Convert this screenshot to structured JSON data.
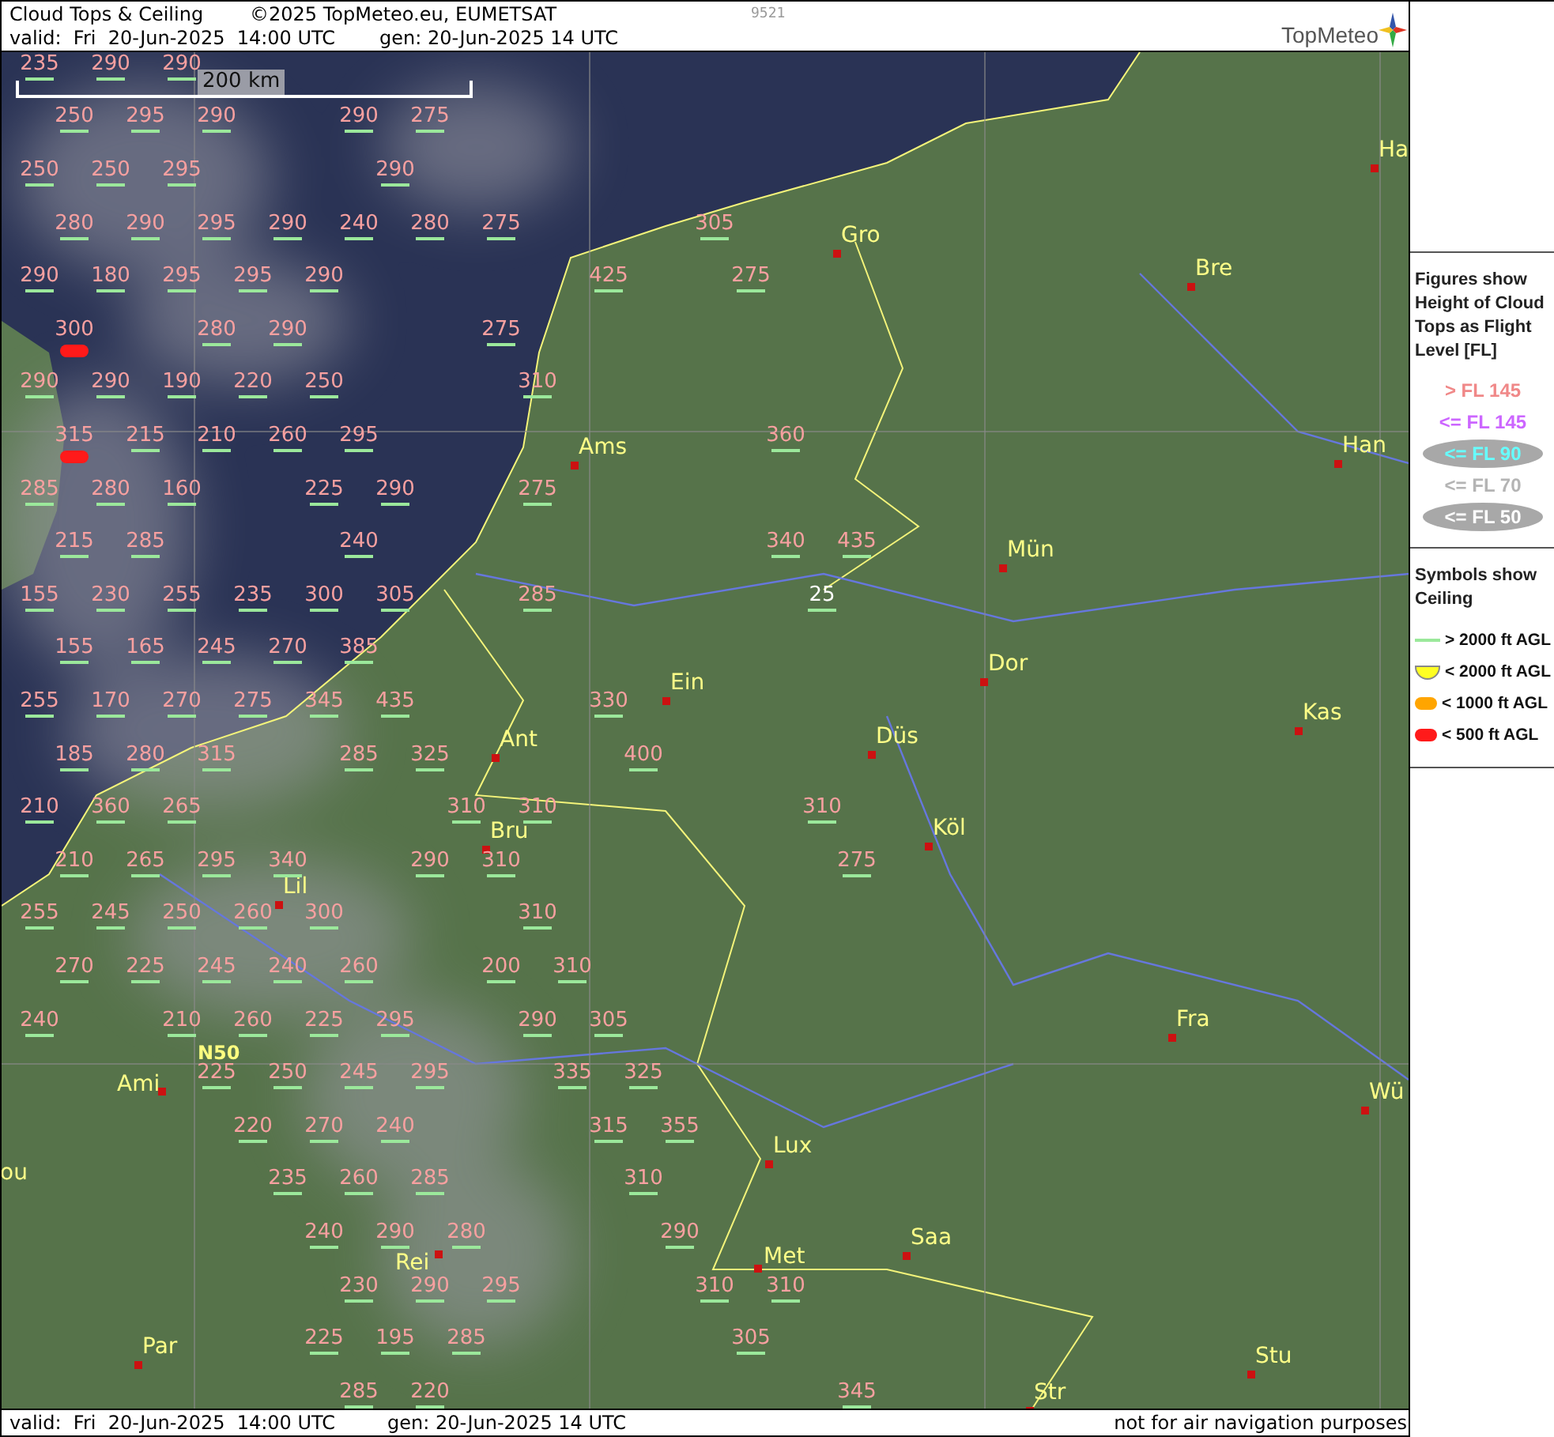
{
  "header": {
    "title": "Cloud Tops & Ceiling",
    "copyright": "©2025 TopMeteo.eu, EUMETSAT",
    "code": "9521",
    "valid": "valid:  Fri  20-Jun-2025  14:00 UTC",
    "generated": "gen: 20-Jun-2025 14 UTC",
    "logo": "TopMeteo"
  },
  "map": {
    "scale": "200 km",
    "grid_label": "N50",
    "rows": [
      [
        {
          "fl": "235",
          "color": "#f7a0a0",
          "kind": "line"
        },
        {
          "fl": "290",
          "color": "#f7a0a0",
          "kind": "line"
        },
        {
          "fl": "290",
          "color": "#f7a0a0",
          "kind": "line"
        }
      ],
      [
        {
          "fl": "250",
          "color": "#f7a0a0",
          "kind": "line"
        },
        {
          "fl": "295",
          "color": "#f7a0a0",
          "kind": "line"
        },
        {
          "fl": "290",
          "color": "#f7a0a0",
          "kind": "line"
        },
        null,
        {
          "fl": "290",
          "color": "#f7a0a0",
          "kind": "line"
        },
        {
          "fl": "275",
          "color": "#f7a0a0",
          "kind": "line"
        }
      ],
      [
        {
          "fl": "250",
          "color": "#f7a0a0",
          "kind": "line"
        },
        {
          "fl": "250",
          "color": "#f7a0a0",
          "kind": "line"
        },
        {
          "fl": "295",
          "color": "#f7a0a0",
          "kind": "line"
        },
        null,
        null,
        {
          "fl": "290",
          "color": "#f7a0a0",
          "kind": "line"
        }
      ],
      [
        {
          "fl": "280",
          "color": "#f7a0a0",
          "kind": "line"
        },
        {
          "fl": "290",
          "color": "#f7a0a0",
          "kind": "line"
        },
        {
          "fl": "295",
          "color": "#f7a0a0",
          "kind": "line"
        },
        {
          "fl": "290",
          "color": "#f7a0a0",
          "kind": "line"
        },
        {
          "fl": "240",
          "color": "#f7a0a0",
          "kind": "line"
        },
        {
          "fl": "280",
          "color": "#f7a0a0",
          "kind": "line"
        },
        {
          "fl": "275",
          "color": "#f7a0a0",
          "kind": "line"
        },
        null,
        null,
        {
          "fl": "305",
          "color": "#f7a0a0",
          "kind": "line"
        }
      ],
      [
        {
          "fl": "290",
          "color": "#f7a0a0",
          "kind": "line"
        },
        {
          "fl": "180",
          "color": "#f7a0a0",
          "kind": "line"
        },
        {
          "fl": "295",
          "color": "#f7a0a0",
          "kind": "line"
        },
        {
          "fl": "295",
          "color": "#f7a0a0",
          "kind": "line"
        },
        {
          "fl": "290",
          "color": "#f7a0a0",
          "kind": "line"
        },
        null,
        null,
        null,
        {
          "fl": "425",
          "color": "#f7a0a0",
          "kind": "line"
        },
        null,
        {
          "fl": "275",
          "color": "#f7a0a0",
          "kind": "line"
        }
      ],
      [
        {
          "fl": "300",
          "color": "#f7a0a0",
          "kind": "red"
        },
        null,
        {
          "fl": "280",
          "color": "#f7a0a0",
          "kind": "line"
        },
        {
          "fl": "290",
          "color": "#f7a0a0",
          "kind": "line"
        },
        null,
        null,
        {
          "fl": "275",
          "color": "#f7a0a0",
          "kind": "line"
        }
      ],
      [
        {
          "fl": "290",
          "color": "#f7a0a0",
          "kind": "line"
        },
        {
          "fl": "290",
          "color": "#f7a0a0",
          "kind": "line"
        },
        {
          "fl": "190",
          "color": "#f7a0a0",
          "kind": "line"
        },
        {
          "fl": "220",
          "color": "#f7a0a0",
          "kind": "line"
        },
        {
          "fl": "250",
          "color": "#f7a0a0",
          "kind": "line"
        },
        null,
        null,
        {
          "fl": "310",
          "color": "#f7a0a0",
          "kind": "line"
        }
      ],
      [
        {
          "fl": "315",
          "color": "#f7a0a0",
          "kind": "red"
        },
        {
          "fl": "215",
          "color": "#f7a0a0",
          "kind": "line"
        },
        {
          "fl": "210",
          "color": "#f7a0a0",
          "kind": "line"
        },
        {
          "fl": "260",
          "color": "#f7a0a0",
          "kind": "line"
        },
        {
          "fl": "295",
          "color": "#f7a0a0",
          "kind": "line"
        },
        null,
        null,
        null,
        null,
        null,
        {
          "fl": "360",
          "color": "#f7a0a0",
          "kind": "line"
        }
      ],
      [
        {
          "fl": "285",
          "color": "#f7a0a0",
          "kind": "line"
        },
        {
          "fl": "280",
          "color": "#f7a0a0",
          "kind": "line"
        },
        {
          "fl": "160",
          "color": "#f7a0a0",
          "kind": "line"
        },
        null,
        {
          "fl": "225",
          "color": "#f7a0a0",
          "kind": "line"
        },
        {
          "fl": "290",
          "color": "#f7a0a0",
          "kind": "line"
        },
        null,
        {
          "fl": "275",
          "color": "#f7a0a0",
          "kind": "line"
        }
      ],
      [
        {
          "fl": "215",
          "color": "#f7a0a0",
          "kind": "line"
        },
        {
          "fl": "285",
          "color": "#f7a0a0",
          "kind": "line"
        },
        null,
        null,
        {
          "fl": "240",
          "color": "#f7a0a0",
          "kind": "line"
        },
        null,
        null,
        null,
        null,
        null,
        {
          "fl": "340",
          "color": "#f7a0a0",
          "kind": "line"
        },
        {
          "fl": "435",
          "color": "#f7a0a0",
          "kind": "line"
        }
      ],
      [
        {
          "fl": "155",
          "color": "#f7a0a0",
          "kind": "line"
        },
        {
          "fl": "230",
          "color": "#f7a0a0",
          "kind": "line"
        },
        {
          "fl": "255",
          "color": "#f7a0a0",
          "kind": "line"
        },
        {
          "fl": "235",
          "color": "#f7a0a0",
          "kind": "line"
        },
        {
          "fl": "300",
          "color": "#f7a0a0",
          "kind": "line"
        },
        {
          "fl": "305",
          "color": "#f7a0a0",
          "kind": "line"
        },
        null,
        {
          "fl": "285",
          "color": "#f7a0a0",
          "kind": "line"
        },
        null,
        null,
        null,
        {
          "fl": "25",
          "color": "#ffffff",
          "kind": "line"
        }
      ],
      [
        {
          "fl": "155",
          "color": "#f7a0a0",
          "kind": "line"
        },
        {
          "fl": "165",
          "color": "#f7a0a0",
          "kind": "line"
        },
        {
          "fl": "245",
          "color": "#f7a0a0",
          "kind": "line"
        },
        {
          "fl": "270",
          "color": "#f7a0a0",
          "kind": "line"
        },
        {
          "fl": "385",
          "color": "#f7a0a0",
          "kind": "line"
        }
      ],
      [
        {
          "fl": "255",
          "color": "#f7a0a0",
          "kind": "line"
        },
        {
          "fl": "170",
          "color": "#f7a0a0",
          "kind": "line"
        },
        {
          "fl": "270",
          "color": "#f7a0a0",
          "kind": "line"
        },
        {
          "fl": "275",
          "color": "#f7a0a0",
          "kind": "line"
        },
        {
          "fl": "345",
          "color": "#f7a0a0",
          "kind": "line"
        },
        {
          "fl": "435",
          "color": "#f7a0a0",
          "kind": "line"
        },
        null,
        null,
        {
          "fl": "330",
          "color": "#f7a0a0",
          "kind": "line"
        }
      ],
      [
        {
          "fl": "185",
          "color": "#f7a0a0",
          "kind": "line"
        },
        {
          "fl": "280",
          "color": "#f7a0a0",
          "kind": "line"
        },
        {
          "fl": "315",
          "color": "#f7a0a0",
          "kind": "line"
        },
        null,
        {
          "fl": "285",
          "color": "#f7a0a0",
          "kind": "line"
        },
        {
          "fl": "325",
          "color": "#f7a0a0",
          "kind": "line"
        },
        null,
        null,
        {
          "fl": "400",
          "color": "#f7a0a0",
          "kind": "line"
        }
      ],
      [
        {
          "fl": "210",
          "color": "#f7a0a0",
          "kind": "line"
        },
        {
          "fl": "360",
          "color": "#f7a0a0",
          "kind": "line"
        },
        {
          "fl": "265",
          "color": "#f7a0a0",
          "kind": "line"
        },
        null,
        null,
        null,
        {
          "fl": "310",
          "color": "#f7a0a0",
          "kind": "line"
        },
        {
          "fl": "310",
          "color": "#f7a0a0",
          "kind": "line"
        },
        null,
        null,
        null,
        {
          "fl": "310",
          "color": "#f7a0a0",
          "kind": "line"
        }
      ],
      [
        {
          "fl": "210",
          "color": "#f7a0a0",
          "kind": "line"
        },
        {
          "fl": "265",
          "color": "#f7a0a0",
          "kind": "line"
        },
        {
          "fl": "295",
          "color": "#f7a0a0",
          "kind": "line"
        },
        {
          "fl": "340",
          "color": "#f7a0a0",
          "kind": "line"
        },
        null,
        {
          "fl": "290",
          "color": "#f7a0a0",
          "kind": "line"
        },
        {
          "fl": "310",
          "color": "#f7a0a0",
          "kind": "line"
        },
        null,
        null,
        null,
        null,
        {
          "fl": "275",
          "color": "#f7a0a0",
          "kind": "line"
        }
      ],
      [
        {
          "fl": "255",
          "color": "#f7a0a0",
          "kind": "line"
        },
        {
          "fl": "245",
          "color": "#f7a0a0",
          "kind": "line"
        },
        {
          "fl": "250",
          "color": "#f7a0a0",
          "kind": "line"
        },
        {
          "fl": "260",
          "color": "#f7a0a0",
          "kind": "line"
        },
        {
          "fl": "300",
          "color": "#f7a0a0",
          "kind": "line"
        },
        null,
        null,
        {
          "fl": "310",
          "color": "#f7a0a0",
          "kind": "line"
        }
      ],
      [
        {
          "fl": "270",
          "color": "#f7a0a0",
          "kind": "line"
        },
        {
          "fl": "225",
          "color": "#f7a0a0",
          "kind": "line"
        },
        {
          "fl": "245",
          "color": "#f7a0a0",
          "kind": "line"
        },
        {
          "fl": "240",
          "color": "#f7a0a0",
          "kind": "line"
        },
        {
          "fl": "260",
          "color": "#f7a0a0",
          "kind": "line"
        },
        null,
        {
          "fl": "200",
          "color": "#f7a0a0",
          "kind": "line"
        },
        {
          "fl": "310",
          "color": "#f7a0a0",
          "kind": "line"
        }
      ],
      [
        {
          "fl": "240",
          "color": "#f7a0a0",
          "kind": "line"
        },
        null,
        {
          "fl": "210",
          "color": "#f7a0a0",
          "kind": "line"
        },
        {
          "fl": "260",
          "color": "#f7a0a0",
          "kind": "line"
        },
        {
          "fl": "225",
          "color": "#f7a0a0",
          "kind": "line"
        },
        {
          "fl": "295",
          "color": "#f7a0a0",
          "kind": "line"
        },
        null,
        {
          "fl": "290",
          "color": "#f7a0a0",
          "kind": "line"
        },
        {
          "fl": "305",
          "color": "#f7a0a0",
          "kind": "line"
        }
      ],
      [
        null,
        null,
        {
          "fl": "225",
          "color": "#f7a0a0",
          "kind": "line"
        },
        {
          "fl": "250",
          "color": "#f7a0a0",
          "kind": "line"
        },
        {
          "fl": "245",
          "color": "#f7a0a0",
          "kind": "line"
        },
        {
          "fl": "295",
          "color": "#f7a0a0",
          "kind": "line"
        },
        null,
        {
          "fl": "335",
          "color": "#f7a0a0",
          "kind": "line"
        },
        {
          "fl": "325",
          "color": "#f7a0a0",
          "kind": "line"
        }
      ],
      [
        null,
        null,
        null,
        {
          "fl": "220",
          "color": "#f7a0a0",
          "kind": "line"
        },
        {
          "fl": "270",
          "color": "#f7a0a0",
          "kind": "line"
        },
        {
          "fl": "240",
          "color": "#f7a0a0",
          "kind": "line"
        },
        null,
        null,
        {
          "fl": "315",
          "color": "#f7a0a0",
          "kind": "line"
        },
        {
          "fl": "355",
          "color": "#f7a0a0",
          "kind": "line"
        }
      ],
      [
        null,
        null,
        null,
        {
          "fl": "235",
          "color": "#f7a0a0",
          "kind": "line"
        },
        {
          "fl": "260",
          "color": "#f7a0a0",
          "kind": "line"
        },
        {
          "fl": "285",
          "color": "#f7a0a0",
          "kind": "line"
        },
        null,
        null,
        {
          "fl": "310",
          "color": "#f7a0a0",
          "kind": "line"
        }
      ],
      [
        null,
        null,
        null,
        null,
        {
          "fl": "240",
          "color": "#f7a0a0",
          "kind": "line"
        },
        {
          "fl": "290",
          "color": "#f7a0a0",
          "kind": "line"
        },
        {
          "fl": "280",
          "color": "#f7a0a0",
          "kind": "line"
        },
        null,
        null,
        {
          "fl": "290",
          "color": "#f7a0a0",
          "kind": "line"
        }
      ],
      [
        null,
        null,
        null,
        null,
        {
          "fl": "230",
          "color": "#f7a0a0",
          "kind": "line"
        },
        {
          "fl": "290",
          "color": "#f7a0a0",
          "kind": "line"
        },
        {
          "fl": "295",
          "color": "#f7a0a0",
          "kind": "line"
        },
        null,
        null,
        {
          "fl": "310",
          "color": "#f7a0a0",
          "kind": "line"
        },
        {
          "fl": "310",
          "color": "#f7a0a0",
          "kind": "line"
        }
      ],
      [
        null,
        null,
        null,
        null,
        {
          "fl": "225",
          "color": "#f7a0a0",
          "kind": "line"
        },
        {
          "fl": "195",
          "color": "#f7a0a0",
          "kind": "line"
        },
        {
          "fl": "285",
          "color": "#f7a0a0",
          "kind": "line"
        },
        null,
        null,
        null,
        {
          "fl": "305",
          "color": "#f7a0a0",
          "kind": "line"
        }
      ],
      [
        null,
        null,
        null,
        null,
        {
          "fl": "285",
          "color": "#f7a0a0",
          "kind": "line"
        },
        {
          "fl": "220",
          "color": "#f7a0a0",
          "kind": "line"
        },
        null,
        null,
        null,
        null,
        null,
        {
          "fl": "345",
          "color": "#f7a0a0",
          "kind": "line"
        }
      ]
    ],
    "cities": [
      {
        "name": "Gro"
      },
      {
        "name": "Bre"
      },
      {
        "name": "Ha"
      },
      {
        "name": "Ams"
      },
      {
        "name": "Han"
      },
      {
        "name": "Mün"
      },
      {
        "name": "Dor"
      },
      {
        "name": "Ein"
      },
      {
        "name": "Ant"
      },
      {
        "name": "Düs"
      },
      {
        "name": "Kas"
      },
      {
        "name": "Bru"
      },
      {
        "name": "Köl"
      },
      {
        "name": "Lil"
      },
      {
        "name": "Fra"
      },
      {
        "name": "Wü"
      },
      {
        "name": "Ami"
      },
      {
        "name": "ou"
      },
      {
        "name": "Lux"
      },
      {
        "name": "Rei"
      },
      {
        "name": "Saa"
      },
      {
        "name": "Met"
      },
      {
        "name": "Par"
      },
      {
        "name": "Stu"
      },
      {
        "name": "Str"
      }
    ]
  },
  "legend": {
    "heights": {
      "title": "Figures show Height of Cloud Tops as Flight Level  [FL]",
      "items": [
        {
          "label": "> FL 145",
          "color": "#f08888",
          "kind": "plain"
        },
        {
          "label": "<= FL 145",
          "color": "#cc66ff",
          "kind": "plain"
        },
        {
          "label": "<= FL 90",
          "color": "#66ffff",
          "kind": "oval"
        },
        {
          "label": "<= FL 70",
          "color": "#b4b4b4",
          "kind": "plain"
        },
        {
          "label": "<= FL 50",
          "color": "#ffffff",
          "kind": "oval"
        }
      ]
    },
    "ceiling": {
      "title": "Symbols show Ceiling",
      "items": [
        {
          "label": "> 2000 ft AGL",
          "kind": "line"
        },
        {
          "label": "< 2000 ft AGL",
          "kind": "moon"
        },
        {
          "label": "< 1000 ft AGL",
          "kind": "orange"
        },
        {
          "label": "< 500 ft AGL",
          "kind": "red"
        }
      ]
    }
  },
  "footer": {
    "valid": "valid:  Fri  20-Jun-2025  14:00 UTC",
    "generated": "gen: 20-Jun-2025 14 UTC",
    "note": "not for air navigation purposes"
  }
}
